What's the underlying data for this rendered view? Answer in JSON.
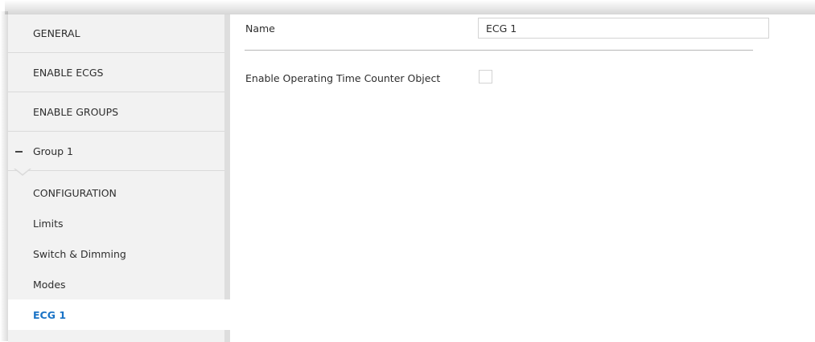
{
  "sidebar": {
    "items": [
      {
        "label": "GENERAL"
      },
      {
        "label": "ENABLE ECGS"
      },
      {
        "label": "ENABLE GROUPS"
      }
    ],
    "group": {
      "label": "Group 1",
      "expanded": true,
      "icon": "minus-icon",
      "children": [
        {
          "label": "CONFIGURATION"
        },
        {
          "label": "Limits"
        },
        {
          "label": "Switch & Dimming"
        },
        {
          "label": "Modes"
        },
        {
          "label": "ECG 1",
          "selected": true
        }
      ]
    },
    "accent_color": "#1a73c6"
  },
  "main": {
    "name_field": {
      "label": "Name",
      "value": "ECG 1"
    },
    "operating_time_counter": {
      "label": "Enable Operating Time Counter Object",
      "checked": false
    }
  }
}
